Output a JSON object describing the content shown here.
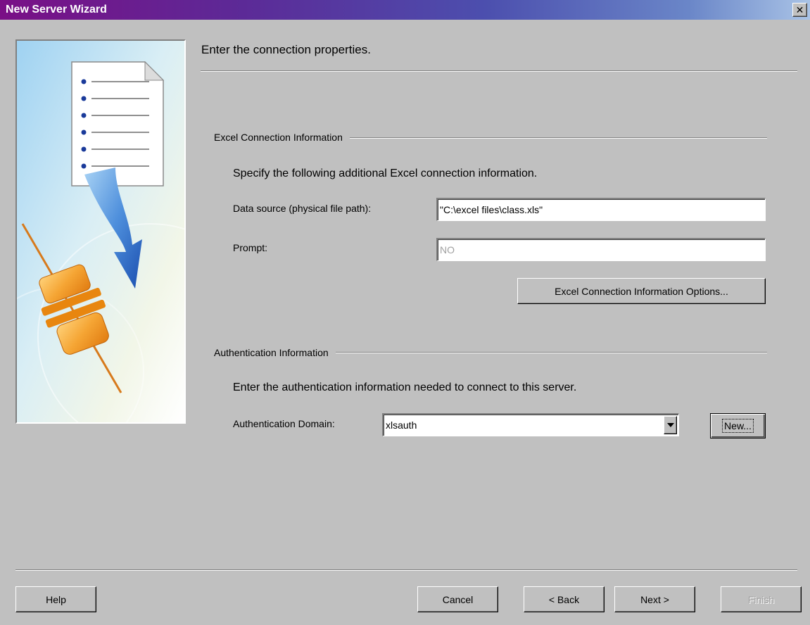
{
  "window": {
    "title": "New Server Wizard",
    "close_glyph": "✕"
  },
  "page": {
    "heading": "Enter the connection properties."
  },
  "illustration": {
    "icon": "document-to-connector-icon"
  },
  "excel_section": {
    "label": "Excel Connection Information",
    "instruction": "Specify the following additional Excel connection information.",
    "data_source_label": "Data source (physical file path):",
    "data_source_value": "\"C:\\excel files\\class.xls\"",
    "prompt_label": "Prompt:",
    "prompt_value": "NO",
    "options_button": "Excel Connection Information Options..."
  },
  "auth_section": {
    "label": "Authentication Information",
    "instruction": "Enter the authentication information needed to connect to this server.",
    "domain_label": "Authentication Domain:",
    "domain_value": "xlsauth",
    "new_button": "New..."
  },
  "footer": {
    "help": "Help",
    "cancel": "Cancel",
    "back": "< Back",
    "next": "Next >",
    "finish": "Finish"
  },
  "colors": {
    "dialog_bg": "#c0c0c0",
    "title_gradient_start": "#7a0f86",
    "title_gradient_end": "#a9c3e6",
    "disabled_text": "#a0a0a0"
  }
}
